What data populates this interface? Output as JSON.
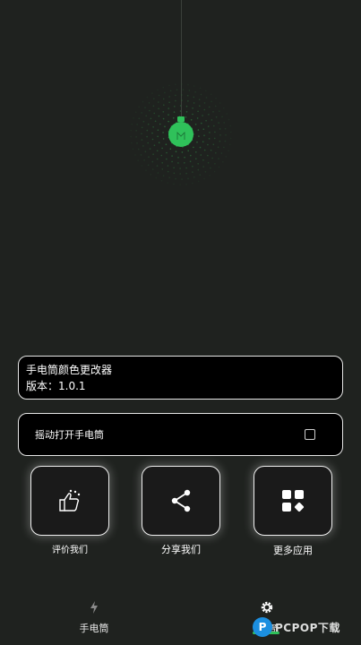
{
  "app": {
    "title": "手电筒颜色更改器",
    "version": "版本：1.0.1"
  },
  "settings": {
    "shake_label": "摇动打开手电筒",
    "shake_checked": false
  },
  "actions": [
    {
      "label": "评价我们",
      "icon": "thumbs-up-icon"
    },
    {
      "label": "分享我们",
      "icon": "share-icon"
    },
    {
      "label": "更多应用",
      "icon": "apps-grid-icon"
    }
  ],
  "nav": {
    "items": [
      {
        "label": "手电筒",
        "icon": "flash-icon"
      },
      {
        "label": "设置",
        "icon": "gear-icon"
      }
    ]
  },
  "colors": {
    "background": "#1f221f",
    "bulb": "#2fc15a",
    "accent": "#2fc15a"
  },
  "watermark": {
    "badge": "P",
    "text": "PCPOP下载"
  }
}
